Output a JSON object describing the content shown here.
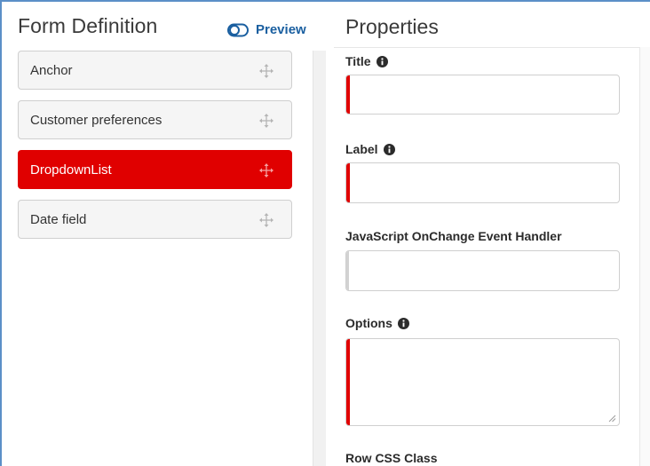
{
  "form_definition": {
    "title": "Form Definition",
    "preview_label": "Preview",
    "fields": [
      {
        "label": "Anchor",
        "active": false
      },
      {
        "label": "Customer preferences",
        "active": false
      },
      {
        "label": "DropdownList",
        "active": true
      },
      {
        "label": "Date field",
        "active": false
      }
    ]
  },
  "properties": {
    "title": "Properties",
    "title_label": "Title",
    "title_value": "",
    "label_label": "Label",
    "label_value": "",
    "onchange_label": "JavaScript OnChange Event Handler",
    "onchange_value": "",
    "options_label": "Options",
    "options_value": "",
    "row_css_label": "Row CSS Class"
  },
  "colors": {
    "accent_red": "#e00000",
    "link_blue": "#1a5fa0",
    "frame_blue": "#5b8fc7"
  },
  "icons": {
    "preview": "toggle-icon",
    "drag": "move-icon",
    "info": "info-circle-icon"
  }
}
